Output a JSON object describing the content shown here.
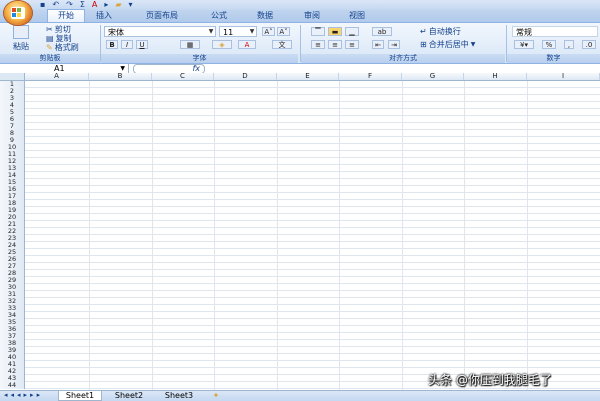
{
  "ribbon_tabs": [
    "开始",
    "插入",
    "页面布局",
    "公式",
    "数据",
    "审阅",
    "视图"
  ],
  "clipboard": {
    "paste": "粘贴",
    "cut": "剪切",
    "copy": "复制",
    "format_painter": "格式刷",
    "label": "剪贴板"
  },
  "font": {
    "name": "宋体",
    "size": "11",
    "label": "字体"
  },
  "alignment": {
    "wrap": "自动换行",
    "merge": "合并后居中",
    "label": "对齐方式"
  },
  "number": {
    "format": "常规",
    "label": "数字"
  },
  "formula_bar": {
    "cell_ref": "A1",
    "fx": "fx"
  },
  "columns": [
    "A",
    "B",
    "C",
    "D",
    "E",
    "F",
    "G",
    "H",
    "I"
  ],
  "rows": [
    "1",
    "2",
    "3",
    "4",
    "5",
    "6",
    "7",
    "8",
    "9",
    "10",
    "11",
    "12",
    "13",
    "14",
    "15",
    "16",
    "17",
    "18",
    "19",
    "20",
    "21",
    "22",
    "23",
    "24",
    "25",
    "26",
    "27",
    "28",
    "29",
    "30",
    "31",
    "32",
    "33",
    "34",
    "35",
    "36",
    "37",
    "38",
    "39",
    "40",
    "41",
    "42",
    "43",
    "44"
  ],
  "sheets": [
    "Sheet1",
    "Sheet2",
    "Sheet3"
  ],
  "watermark": "头条 @你压到我腿毛了",
  "colors": {
    "accent": "#15428b",
    "ribbon": "#d8e6f7",
    "grid": "#dfe6ee"
  }
}
